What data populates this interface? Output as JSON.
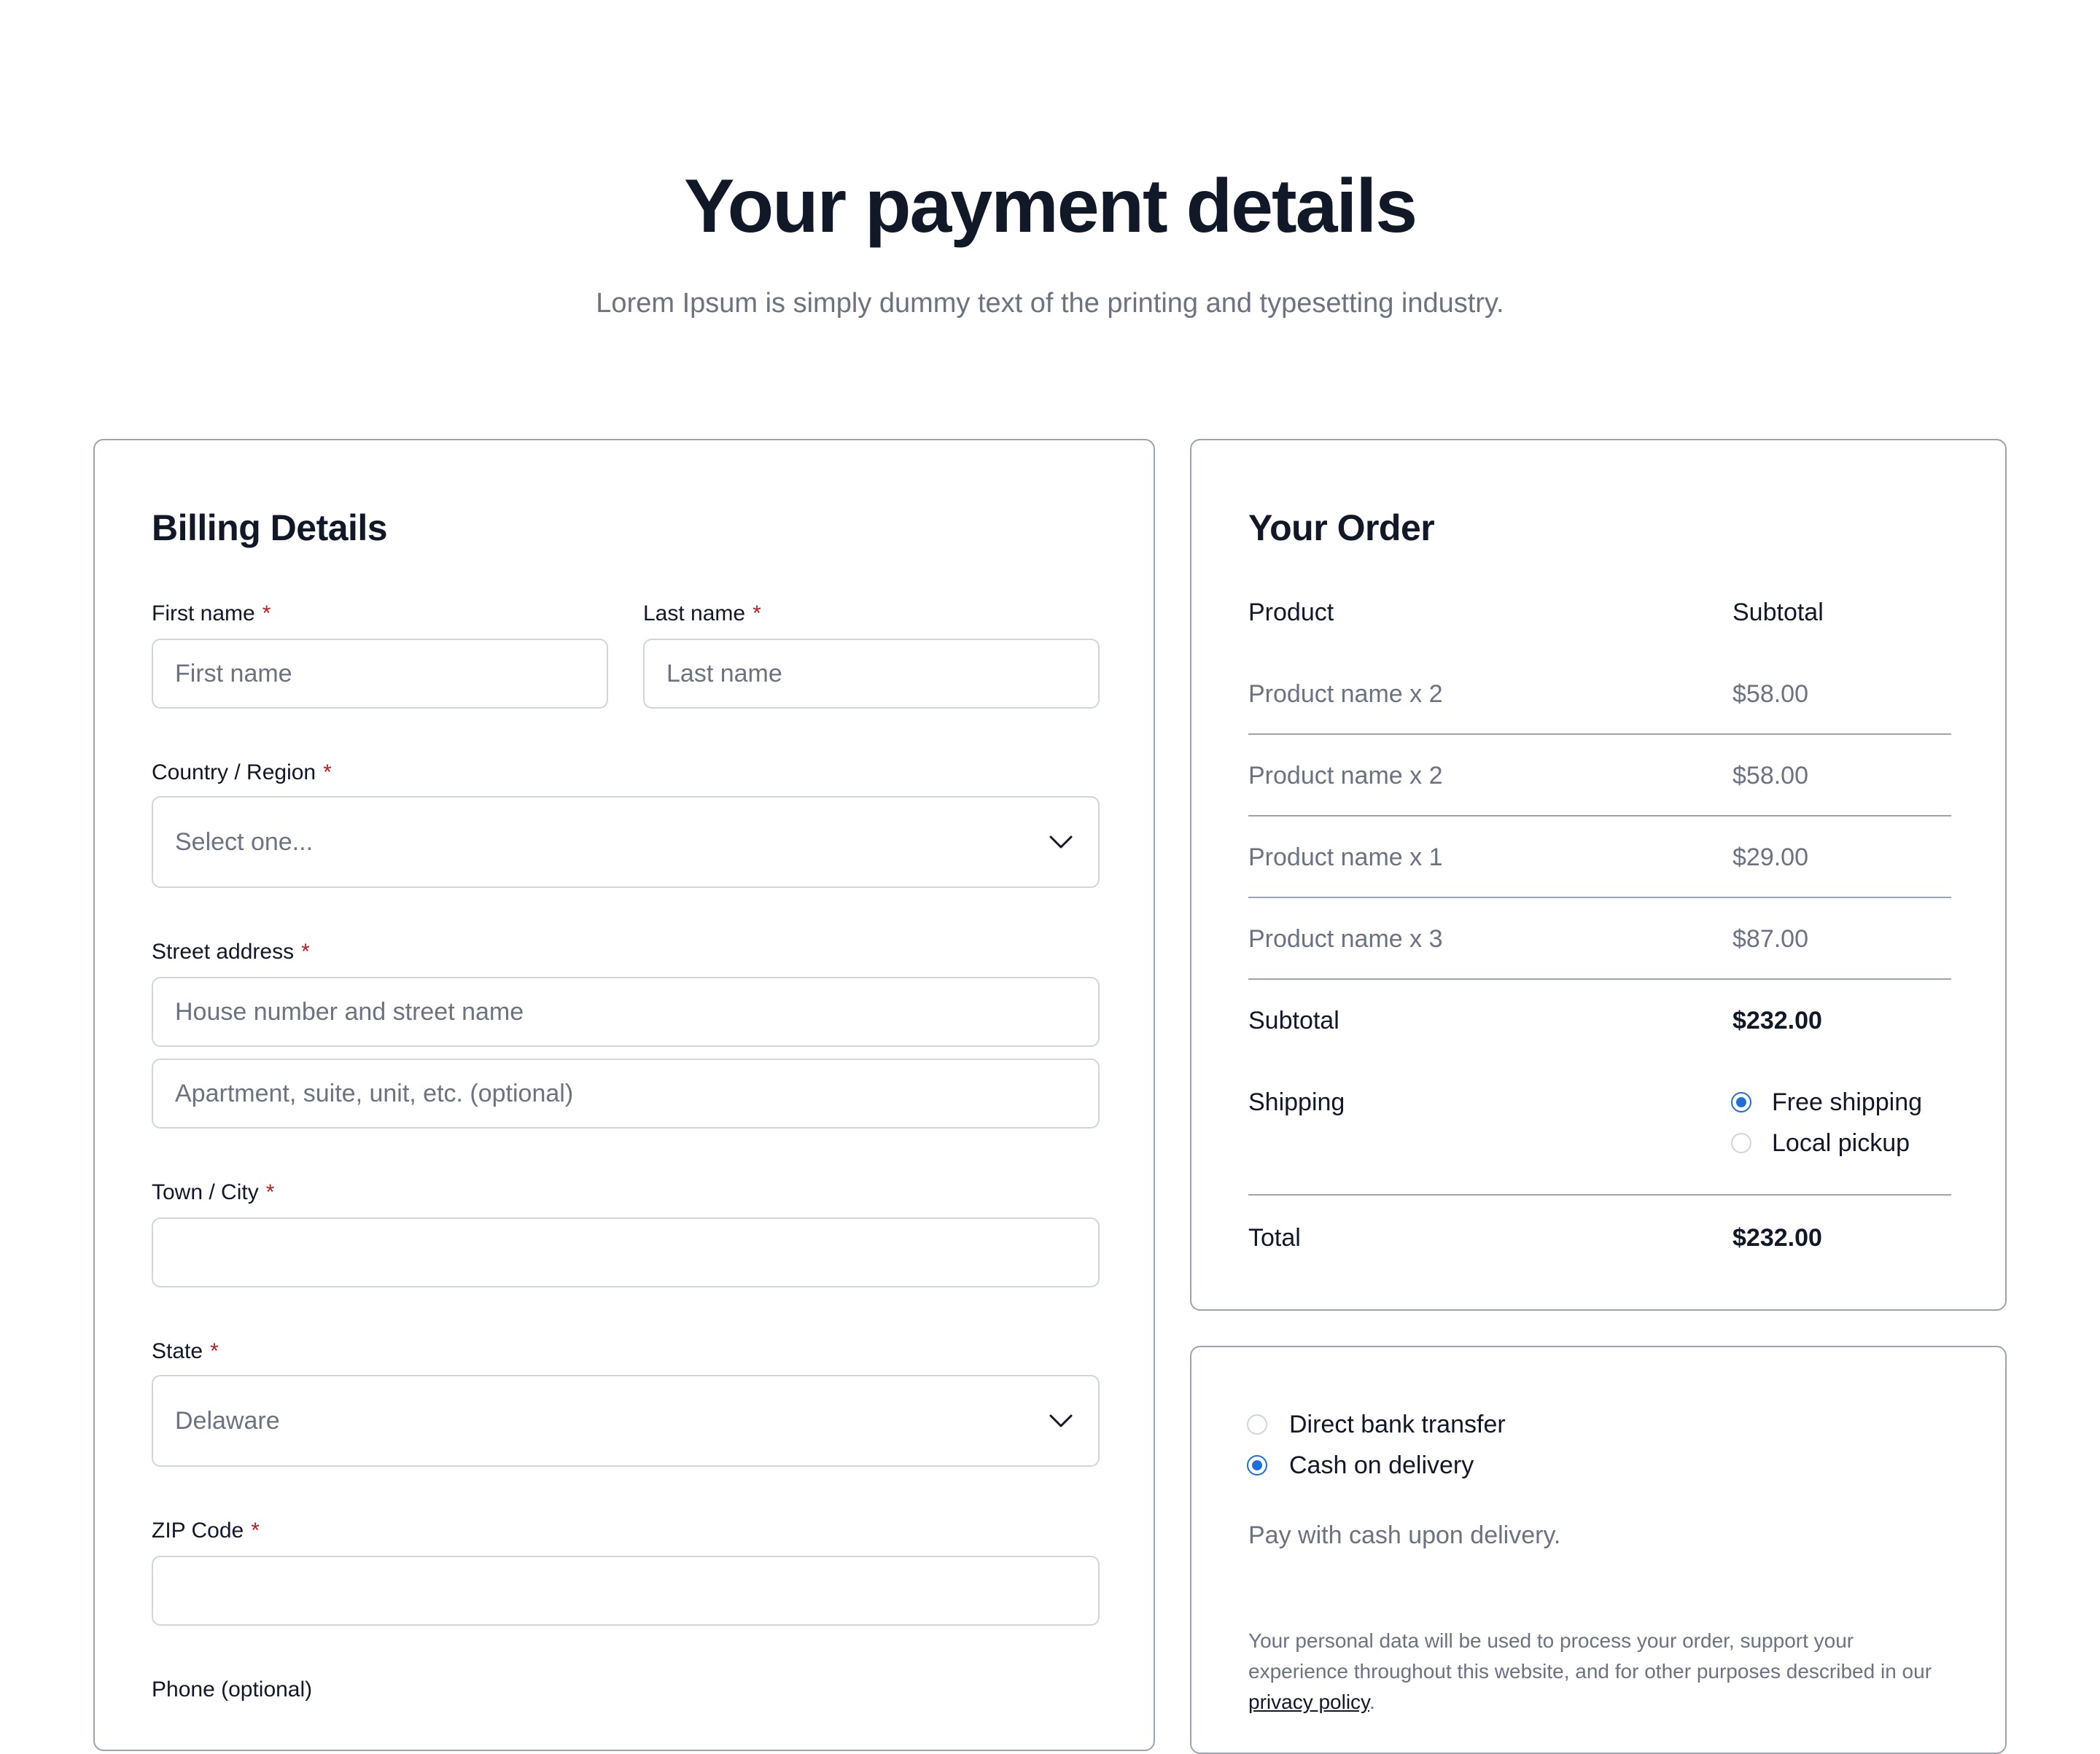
{
  "header": {
    "title": "Your payment details",
    "subtitle": "Lorem Ipsum is simply dummy text of the printing and typesetting industry."
  },
  "billing": {
    "title": "Billing Details",
    "required_mark": "*",
    "first_name": {
      "label": "First name",
      "placeholder": "First name"
    },
    "last_name": {
      "label": "Last name",
      "placeholder": "Last name"
    },
    "country": {
      "label": "Country / Region",
      "value": "Select one..."
    },
    "street": {
      "label": "Street address",
      "placeholder_1": "House number and street name",
      "placeholder_2": "Apartment, suite, unit, etc. (optional)"
    },
    "city": {
      "label": "Town / City",
      "value": ""
    },
    "state": {
      "label": "State",
      "value": "Delaware"
    },
    "zip": {
      "label": "ZIP Code",
      "value": ""
    },
    "phone": {
      "label": "Phone (optional)"
    }
  },
  "order": {
    "title": "Your Order",
    "col_product": "Product",
    "col_subtotal": "Subtotal",
    "items": [
      {
        "name": "Product name x 2",
        "price": "$58.00"
      },
      {
        "name": "Product name x 2",
        "price": "$58.00"
      },
      {
        "name": "Product name x 1",
        "price": "$29.00"
      },
      {
        "name": "Product name x 3",
        "price": "$87.00"
      }
    ],
    "subtotal_label": "Subtotal",
    "subtotal_value": "$232.00",
    "shipping_label": "Shipping",
    "shipping_options": [
      {
        "label": "Free shipping",
        "selected": true
      },
      {
        "label": "Local pickup",
        "selected": false
      }
    ],
    "total_label": "Total",
    "total_value": "$232.00"
  },
  "payment": {
    "methods": [
      {
        "label": "Direct bank transfer",
        "selected": false
      },
      {
        "label": "Cash on delivery",
        "selected": true
      }
    ],
    "note": "Pay with cash upon delivery.",
    "privacy_text": "Your personal data will be used to process your order, support your experience throughout this website, and for other purposes described in our ",
    "privacy_link": "privacy policy",
    "privacy_end": "."
  },
  "colors": {
    "accent": "#1d6fdc",
    "required": "#b91c1c",
    "muted_text": "#6b7280",
    "border": "#9ca3af"
  }
}
